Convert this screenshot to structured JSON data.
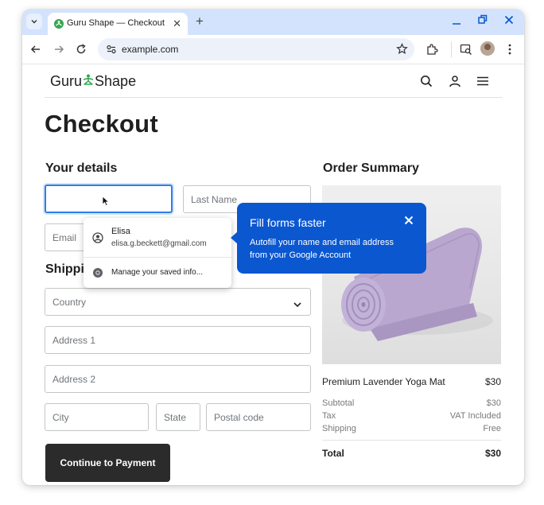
{
  "browser": {
    "tab_title": "Guru Shape — Checkout",
    "url": "example.com"
  },
  "site": {
    "logo_left": "Guru",
    "logo_right": "Shape"
  },
  "checkout": {
    "title": "Checkout",
    "your_details_title": "Your details",
    "first_name_placeholder": "",
    "last_name_placeholder": "Last Name",
    "email_placeholder": "Email",
    "shipping_title_visible": "Shippi",
    "country_placeholder": "Country",
    "address1_placeholder": "Address 1",
    "address2_placeholder": "Address 2",
    "city_placeholder": "City",
    "state_placeholder": "State",
    "postal_placeholder": "Postal code",
    "continue_button": "Continue to Payment"
  },
  "autofill_dropdown": {
    "name": "Elisa",
    "email": "elisa.g.beckett@gmail.com",
    "manage_label": "Manage your saved info..."
  },
  "promo_bubble": {
    "title": "Fill forms faster",
    "body": "Autofill your name and email address from your Google Account"
  },
  "order_summary": {
    "title": "Order Summary",
    "product_name": "Premium Lavender Yoga Mat",
    "product_price": "$30",
    "subtotal_label": "Subtotal",
    "subtotal_value": "$30",
    "tax_label": "Tax",
    "tax_value": "VAT Included",
    "shipping_label": "Shipping",
    "shipping_value": "Free",
    "total_label": "Total",
    "total_value": "$30"
  },
  "colors": {
    "accent_blue": "#0b57d0",
    "tabstrip": "#d3e3fd",
    "button_dark": "#2b2b2b",
    "mat_lavender": "#b9a7cf"
  }
}
